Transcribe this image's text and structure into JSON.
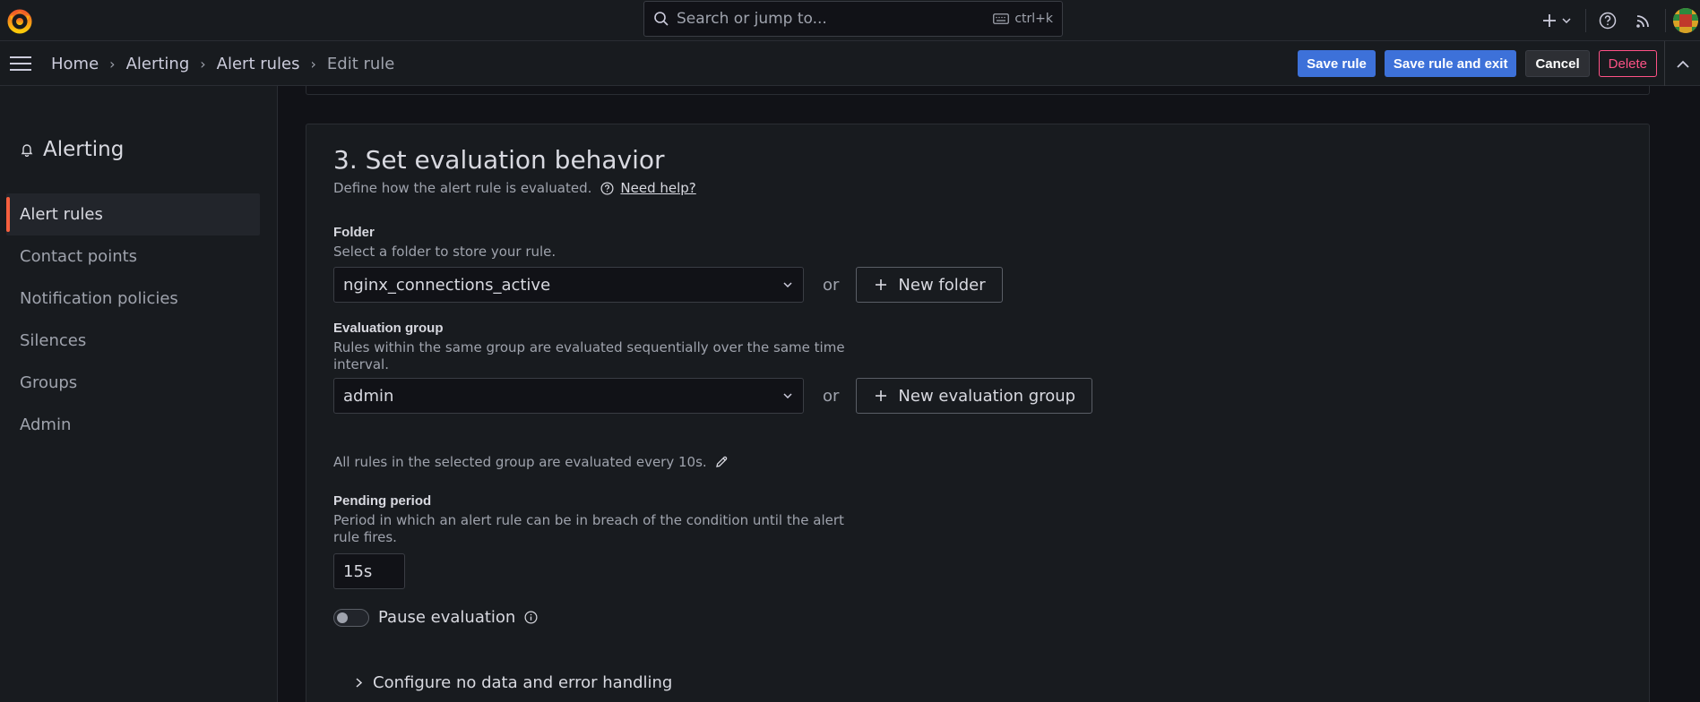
{
  "search": {
    "placeholder": "Search or jump to...",
    "shortcut": "ctrl+k"
  },
  "breadcrumb": [
    {
      "label": "Home"
    },
    {
      "label": "Alerting"
    },
    {
      "label": "Alert rules"
    },
    {
      "label": "Edit rule"
    }
  ],
  "actions": {
    "save": "Save rule",
    "save_exit": "Save rule and exit",
    "cancel": "Cancel",
    "delete": "Delete"
  },
  "sidebar": {
    "title": "Alerting",
    "items": [
      {
        "label": "Alert rules",
        "active": true
      },
      {
        "label": "Contact points"
      },
      {
        "label": "Notification policies"
      },
      {
        "label": "Silences"
      },
      {
        "label": "Groups"
      },
      {
        "label": "Admin"
      }
    ]
  },
  "section": {
    "title": "3. Set evaluation behavior",
    "description": "Define how the alert rule is evaluated.",
    "help_link": "Need help?"
  },
  "folder": {
    "label": "Folder",
    "hint": "Select a folder to store your rule.",
    "value": "nginx_connections_active",
    "or": "or",
    "new_button": "New folder"
  },
  "evaluation_group": {
    "label": "Evaluation group",
    "hint": "Rules within the same group are evaluated sequentially over the same time interval.",
    "value": "admin",
    "or": "or",
    "new_button": "New evaluation group",
    "note": "All rules in the selected group are evaluated every 10s."
  },
  "pending_period": {
    "label": "Pending period",
    "hint": "Period in which an alert rule can be in breach of the condition until the alert rule fires.",
    "value": "15s"
  },
  "pause": {
    "label": "Pause evaluation",
    "enabled": false
  },
  "no_data": {
    "label": "Configure no data and error handling"
  },
  "colors": {
    "background": "#111217",
    "panel": "#181b1f",
    "primary": "#3d71d9",
    "danger": "#ff5286",
    "accent": "#f55f3e"
  },
  "icons": [
    "grafana-logo",
    "search-icon",
    "keyboard-icon",
    "plus-icon",
    "chevron-down-icon",
    "help-icon",
    "rss-icon",
    "menu-icon",
    "bell-icon",
    "pencil-icon",
    "info-icon",
    "chevron-right-icon",
    "chevron-up-icon"
  ]
}
